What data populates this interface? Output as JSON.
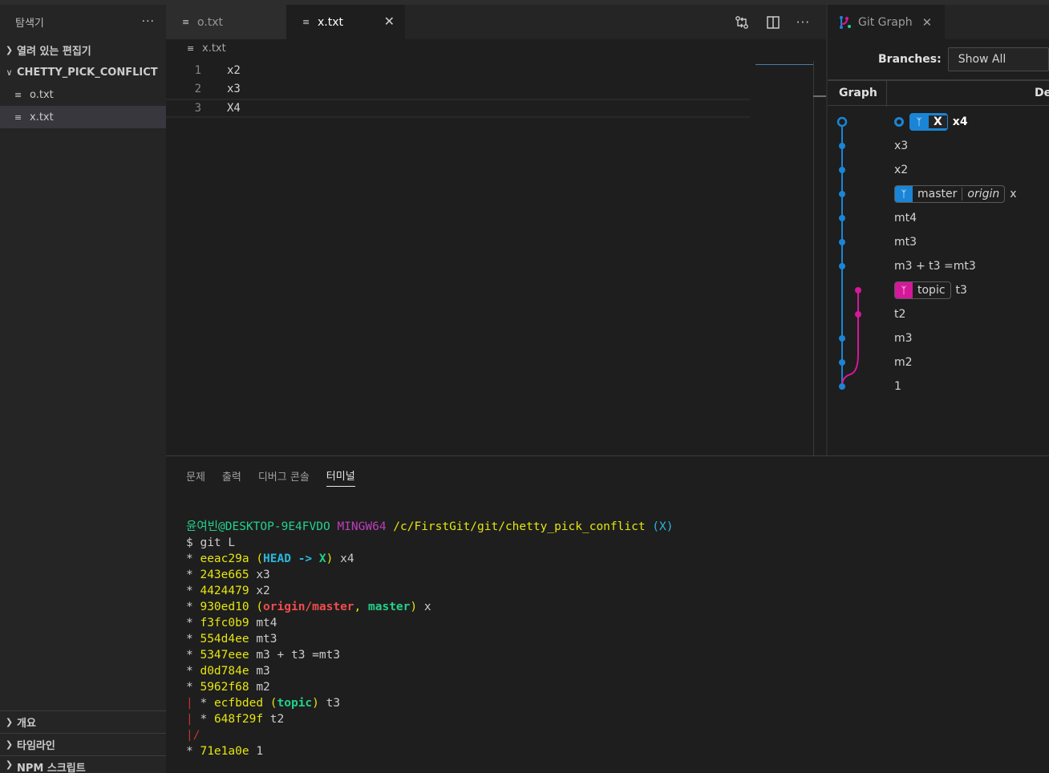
{
  "sidebar": {
    "title": "탐색기",
    "more": "···",
    "open_editors": "열려 있는 편집기",
    "project": "CHETTY_PICK_CONFLICT",
    "files": [
      "o.txt",
      "x.txt"
    ],
    "bottom_sections": [
      "개요",
      "타임라인",
      "NPM 스크립트"
    ]
  },
  "editor": {
    "tabs": [
      {
        "label": "o.txt",
        "active": false
      },
      {
        "label": "x.txt",
        "active": true
      }
    ],
    "breadcrumb": "x.txt",
    "lines": [
      {
        "num": "1",
        "text": "x2"
      },
      {
        "num": "2",
        "text": "x3"
      },
      {
        "num": "3",
        "text": "X4"
      }
    ]
  },
  "gitgraph": {
    "tab_label": "Git Graph",
    "branches_label": "Branches:",
    "branches_value": "Show All",
    "col_graph": "Graph",
    "col_desc": "De",
    "commits": [
      {
        "refs": [
          {
            "name": "X",
            "type": "head"
          }
        ],
        "message": "x4"
      },
      {
        "refs": [],
        "message": "x3"
      },
      {
        "refs": [],
        "message": "x2"
      },
      {
        "refs": [
          {
            "name": "master",
            "remote": "origin",
            "type": "branch"
          }
        ],
        "message": "x"
      },
      {
        "refs": [],
        "message": "mt4"
      },
      {
        "refs": [],
        "message": "mt3"
      },
      {
        "refs": [],
        "message": "m3 + t3 =mt3"
      },
      {
        "refs": [
          {
            "name": "topic",
            "type": "topic"
          }
        ],
        "message": "t3"
      },
      {
        "refs": [],
        "message": "t2"
      },
      {
        "refs": [],
        "message": "m3"
      },
      {
        "refs": [],
        "message": "m2"
      },
      {
        "refs": [],
        "message": "1"
      }
    ],
    "colors": {
      "main": "#1a85d6",
      "topic": "#d4189a"
    }
  },
  "panel": {
    "tabs": [
      "문제",
      "출력",
      "디버그 콘솔",
      "터미널"
    ],
    "active_tab": "터미널",
    "prompt": {
      "user": "윤여빈@DESKTOP-9E4FVDO",
      "env": "MINGW64",
      "path": "/c/FirstGit/git/chetty_pick_conflict",
      "branch": "(X)"
    },
    "command": "$ git L",
    "log": [
      {
        "prefix": "* ",
        "hash": "eeac29a",
        "refs": "HEAD -> X",
        "msg": "x4"
      },
      {
        "prefix": "* ",
        "hash": "243e665",
        "refs": "",
        "msg": "x3"
      },
      {
        "prefix": "* ",
        "hash": "4424479",
        "refs": "",
        "msg": "x2"
      },
      {
        "prefix": "* ",
        "hash": "930ed10",
        "refs": "origin/master, master",
        "msg": "x"
      },
      {
        "prefix": "* ",
        "hash": "f3fc0b9",
        "refs": "",
        "msg": "mt4"
      },
      {
        "prefix": "* ",
        "hash": "554d4ee",
        "refs": "",
        "msg": "mt3"
      },
      {
        "prefix": "* ",
        "hash": "5347eee",
        "refs": "",
        "msg": "m3 + t3 =mt3"
      },
      {
        "prefix": "* ",
        "hash": "d0d784e",
        "refs": "",
        "msg": "m3"
      },
      {
        "prefix": "* ",
        "hash": "5962f68",
        "refs": "",
        "msg": "m2"
      },
      {
        "prefix": "| * ",
        "hash": "ecfbded",
        "refs": "topic",
        "msg": "t3"
      },
      {
        "prefix": "| * ",
        "hash": "648f29f",
        "refs": "",
        "msg": "t2"
      },
      {
        "prefix": "|/",
        "hash": "",
        "refs": "",
        "msg": ""
      },
      {
        "prefix": "* ",
        "hash": "71e1a0e",
        "refs": "",
        "msg": "1"
      }
    ]
  }
}
